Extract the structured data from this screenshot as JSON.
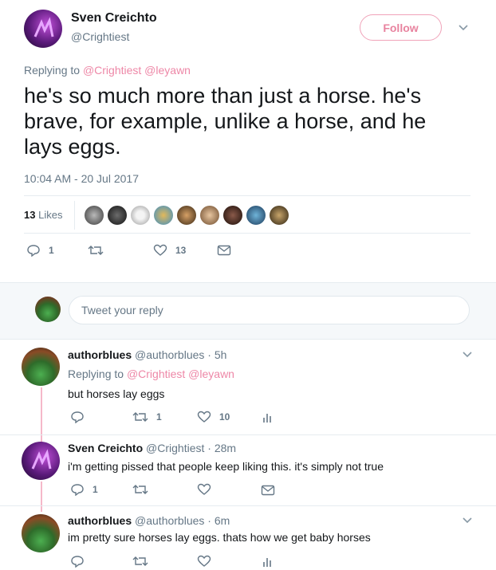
{
  "tweet": {
    "author_name": "Sven Creichto",
    "author_handle": "@Crightiest",
    "follow_label": "Follow",
    "replying_prefix": "Replying to",
    "replying_handles": "@Crightiest @leyawn",
    "text": "he's so much more than just a horse. he's brave, for example, unlike a horse, and he lays eggs.",
    "timestamp": "10:04 AM - 20 Jul 2017",
    "likes_count": "13",
    "likes_label": "Likes",
    "actions": {
      "reply_count": "1",
      "retweet_count": "",
      "like_count": "13"
    }
  },
  "compose": {
    "placeholder": "Tweet your reply"
  },
  "replies": [
    {
      "name": "authorblues",
      "handle": "@authorblues",
      "time": "· 5h",
      "replying_prefix": "Replying to",
      "replying_handles": "@Crightiest @leyawn",
      "text": "but horses lay eggs",
      "reply_count": "",
      "retweet_count": "1",
      "like_count": "10"
    },
    {
      "name": "Sven Creichto",
      "handle": "@Crightiest",
      "time": "· 28m",
      "text": "i'm getting pissed that people keep liking this. it's simply not true",
      "reply_count": "1",
      "retweet_count": "",
      "like_count": ""
    },
    {
      "name": "authorblues",
      "handle": "@authorblues",
      "time": "· 6m",
      "text": "im pretty sure horses lay eggs. thats how we get baby horses",
      "reply_count": "",
      "retweet_count": "",
      "like_count": ""
    }
  ],
  "colors": {
    "accent": "#e0245e",
    "thread_line": "#f5b8c9",
    "muted": "#657786"
  },
  "icons": [
    "reply-icon",
    "retweet-icon",
    "heart-icon",
    "message-icon",
    "chevron-down-icon",
    "analytics-icon"
  ]
}
